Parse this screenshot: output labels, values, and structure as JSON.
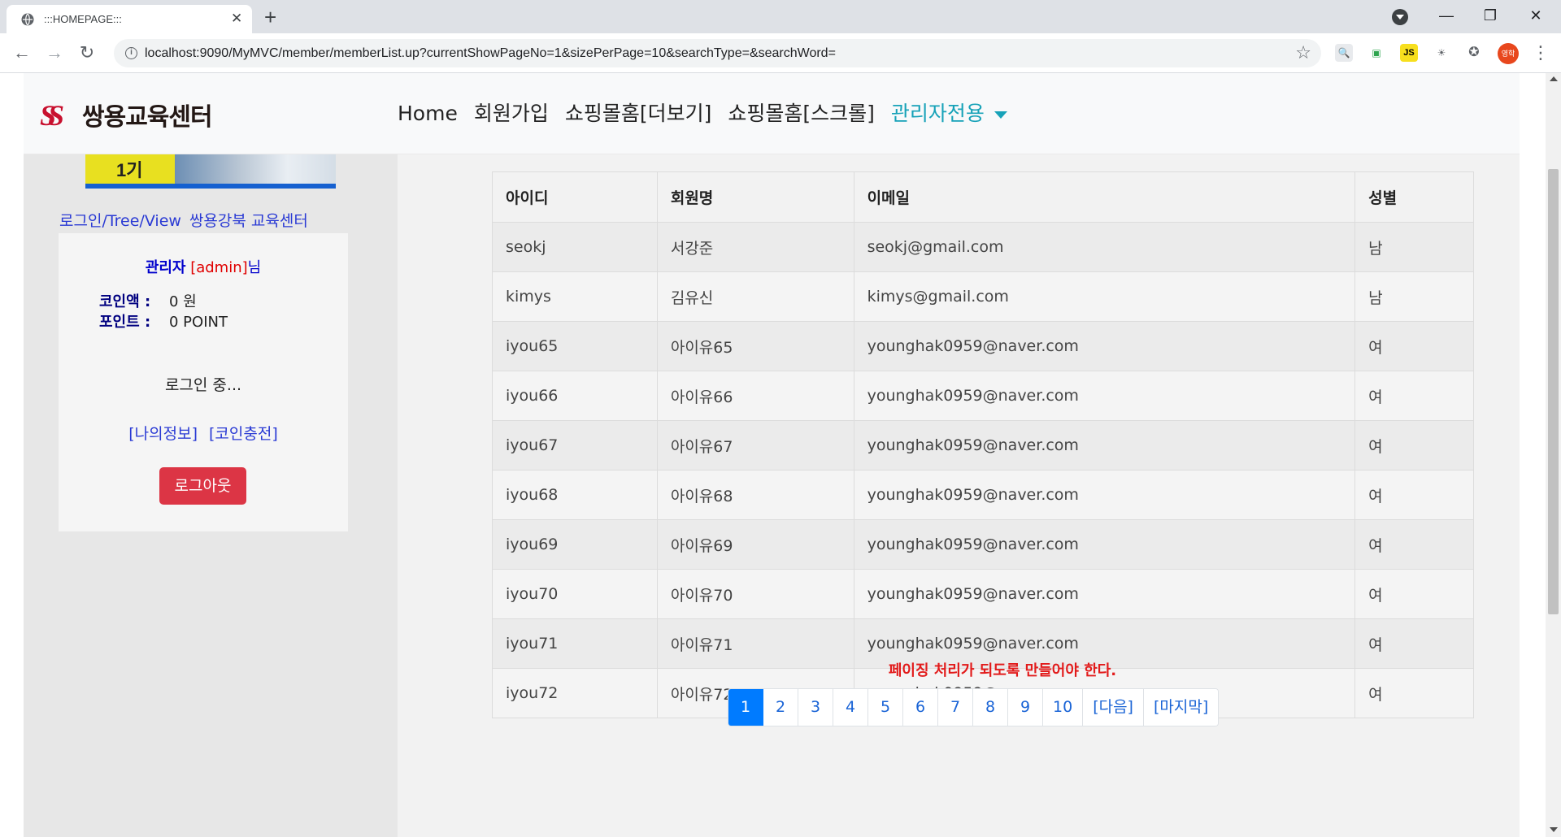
{
  "browser": {
    "tab_title": ":::HOMEPAGE:::",
    "tab_close": "✕",
    "new_tab": "+",
    "url": "localhost:9090/MyMVC/member/memberList.up?currentShowPageNo=1&sizePerPage=10&searchType=&searchWord=",
    "profile_badge": "영학",
    "ext_js_label": "JS"
  },
  "navbar": {
    "logo_mark": "SS",
    "logo_text": "쌍용교육센터",
    "menu": [
      {
        "label": "Home"
      },
      {
        "label": "회원가입"
      },
      {
        "label": "쇼핑몰홈[더보기]"
      },
      {
        "label": "쇼핑몰홈[스크롤]"
      },
      {
        "label": "관리자전용"
      }
    ]
  },
  "sidebar": {
    "banner_label": "1기",
    "link_login_tree": "로그인/Tree/View",
    "link_center": "쌍용강북 교육센터",
    "user": {
      "role": "관리자",
      "id_display": "[admin]",
      "suffix": "님"
    },
    "coin_label": "코인액 :",
    "coin_value": "0 원",
    "point_label": "포인트 :",
    "point_value": "0 POINT",
    "status": "로그인 중...",
    "my_info_link": "[나의정보]",
    "coin_charge_link": "[코인충전]",
    "logout_label": "로그아웃"
  },
  "table": {
    "headers": [
      "아이디",
      "회원명",
      "이메일",
      "성별"
    ],
    "rows": [
      [
        "seokj",
        "서강준",
        "seokj@gmail.com",
        "남"
      ],
      [
        "kimys",
        "김유신",
        "kimys@gmail.com",
        "남"
      ],
      [
        "iyou65",
        "아이유65",
        "younghak0959@naver.com",
        "여"
      ],
      [
        "iyou66",
        "아이유66",
        "younghak0959@naver.com",
        "여"
      ],
      [
        "iyou67",
        "아이유67",
        "younghak0959@naver.com",
        "여"
      ],
      [
        "iyou68",
        "아이유68",
        "younghak0959@naver.com",
        "여"
      ],
      [
        "iyou69",
        "아이유69",
        "younghak0959@naver.com",
        "여"
      ],
      [
        "iyou70",
        "아이유70",
        "younghak0959@naver.com",
        "여"
      ],
      [
        "iyou71",
        "아이유71",
        "younghak0959@naver.com",
        "여"
      ],
      [
        "iyou72",
        "아이유72",
        "younghak0959@naver.com",
        "여"
      ]
    ]
  },
  "notice": "페이징 처리가 되도록 만들어야 한다.",
  "pagination": {
    "pages": [
      "1",
      "2",
      "3",
      "4",
      "5",
      "6",
      "7",
      "8",
      "9",
      "10",
      "[다음]",
      "[마지막]"
    ],
    "active_index": 0
  },
  "colors": {
    "admin_menu": "#17a2b8",
    "logout_button": "#dc3545",
    "active_page": "#007bff",
    "notice": "#e21b1b"
  }
}
